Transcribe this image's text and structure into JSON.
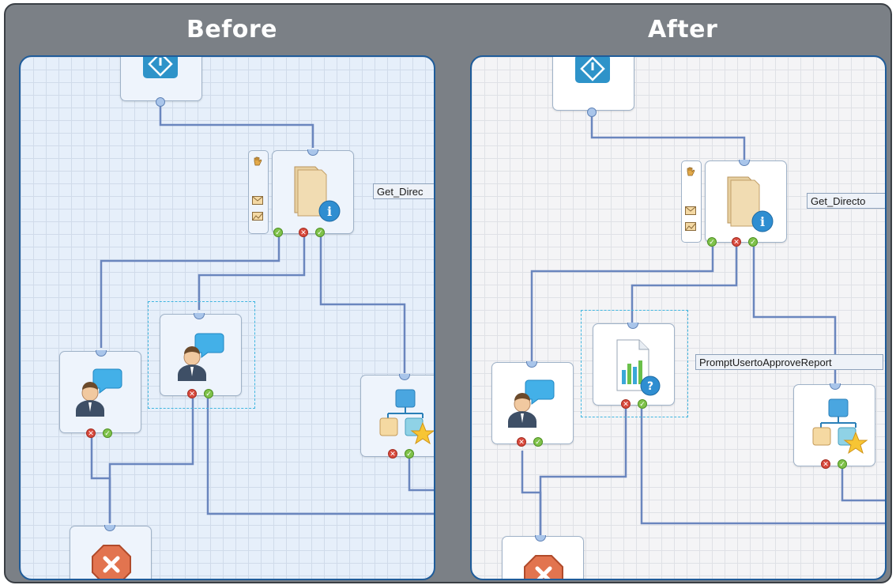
{
  "comparison": {
    "before_title": "Before",
    "after_title": "After"
  },
  "before": {
    "directory_label": "Get_Direc",
    "nodes": [
      "start",
      "get-directory",
      "user-prompt-left",
      "user-prompt-selected",
      "org-chart",
      "error-end"
    ]
  },
  "after": {
    "directory_label": "Get_Directo",
    "prompt_report_label": "PromptUsertoApproveReport",
    "nodes": [
      "start",
      "get-directory",
      "user-prompt-left",
      "report-approval-selected",
      "org-chart",
      "error-end"
    ]
  },
  "colors": {
    "frame": "#7b8086",
    "panel_border": "#1f5c9a",
    "before_canvas": "#e6effa",
    "after_canvas": "#f4f4f6",
    "wire": "#6a86be",
    "selection": "#3fb6e0",
    "status_fail": "#d8493c",
    "status_ok": "#7fc24a"
  },
  "icons": [
    "start-diamond-icon",
    "folder-info-icon",
    "person-speech-icon",
    "org-chart-star-icon",
    "error-octagon-icon",
    "report-question-icon",
    "hand-icon",
    "envelope-icon",
    "message-icon"
  ]
}
